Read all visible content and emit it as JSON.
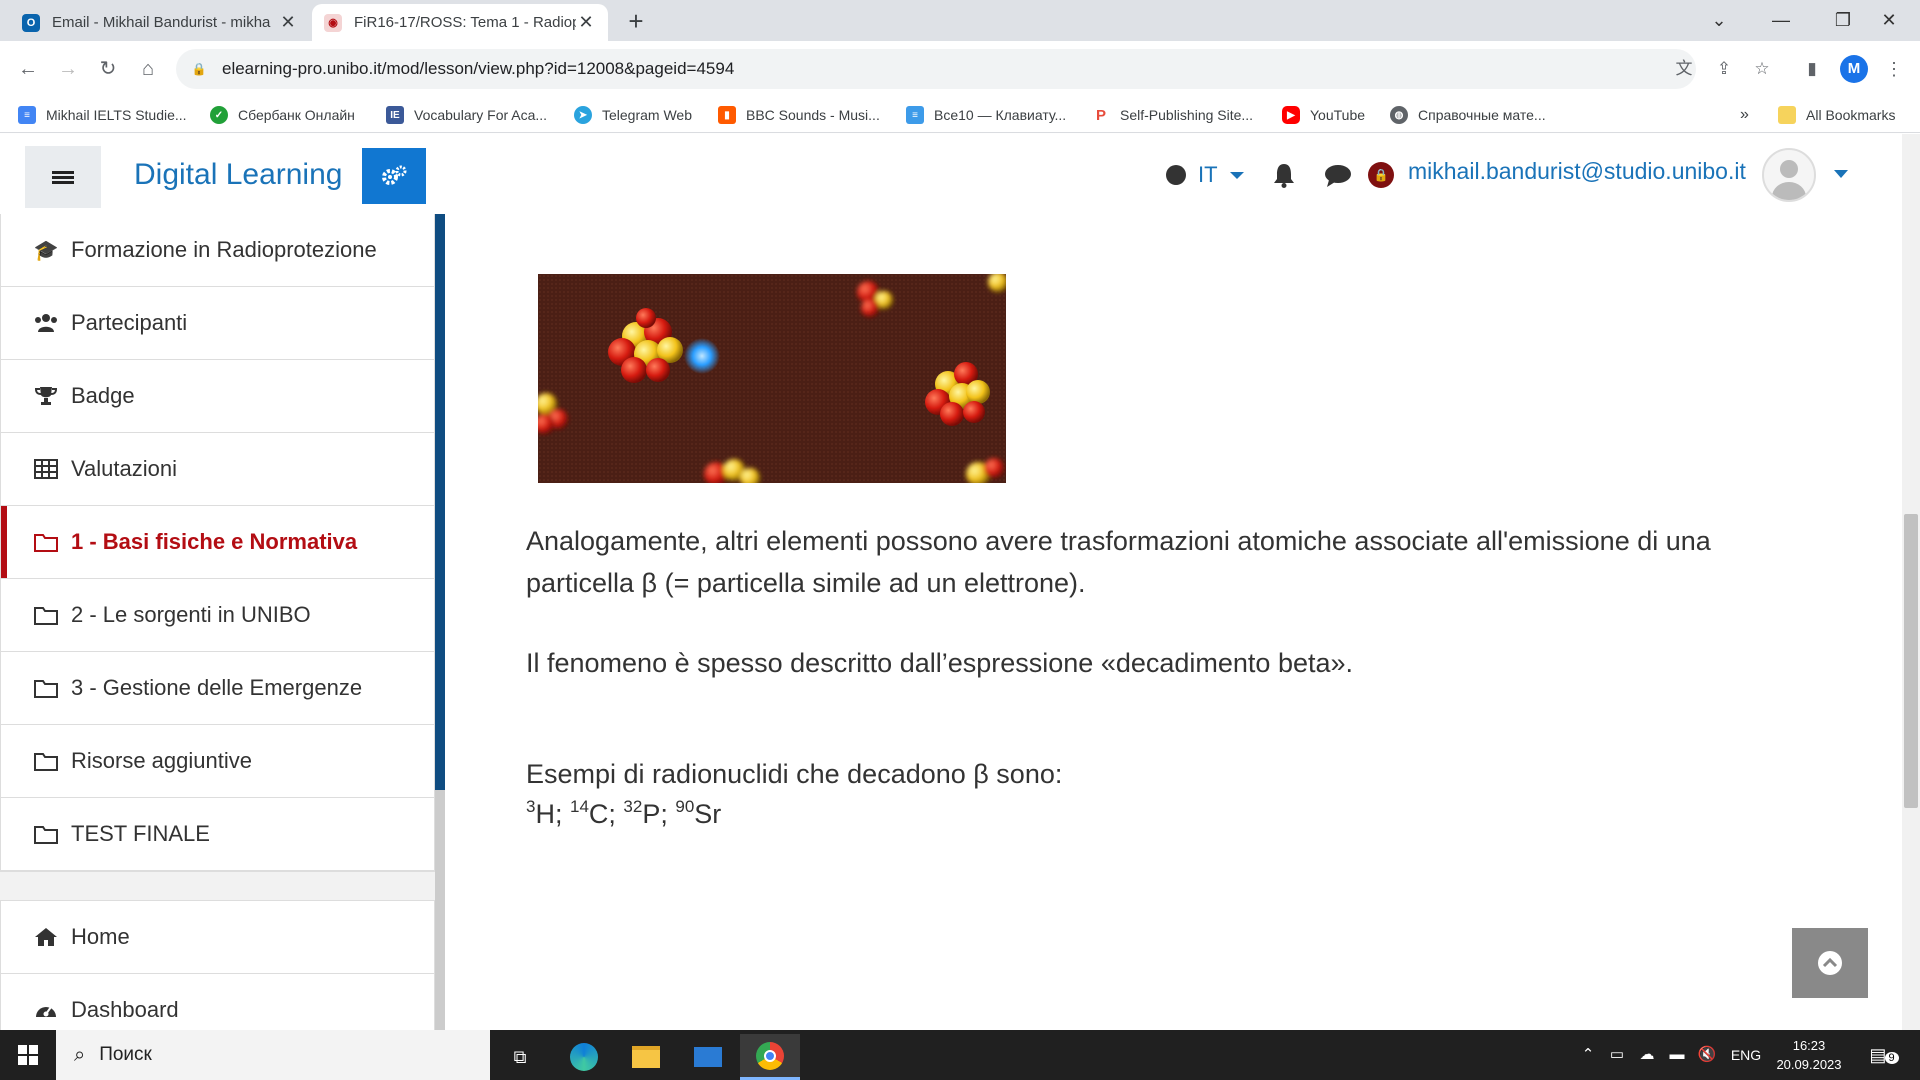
{
  "browser": {
    "tabs": [
      {
        "title": "Email - Mikhail Bandurist - mikha",
        "favicon": "outlook-icon"
      },
      {
        "title": "FiR16-17/ROSS: Tema 1 - Radiopr",
        "favicon": "unibo-icon"
      }
    ],
    "url": "elearning-pro.unibo.it/mod/lesson/view.php?id=12008&pageid=4594",
    "profile_initial": "M",
    "bookmarks": [
      {
        "label": "Mikhail IELTS Studie...",
        "icon": "docs-icon",
        "color": "#4285f4"
      },
      {
        "label": "Сбербанк Онлайн",
        "icon": "sber-icon",
        "color": "#21a038"
      },
      {
        "label": "Vocabulary For Aca...",
        "icon": "ielts-icon",
        "color": "#3b5998"
      },
      {
        "label": "Telegram Web",
        "icon": "telegram-icon",
        "color": "#2aa3de"
      },
      {
        "label": "BBC Sounds - Musi...",
        "icon": "bbc-icon",
        "color": "#ff5a00"
      },
      {
        "label": "Все10 — Клавиату...",
        "icon": "vse10-icon",
        "color": "#3d9be9"
      },
      {
        "label": "Self-Publishing Site...",
        "icon": "publishing-icon",
        "color": "#e74c3c"
      },
      {
        "label": "YouTube",
        "icon": "youtube-icon",
        "color": "#ff0000"
      },
      {
        "label": "Справочные мате...",
        "icon": "globe-icon",
        "color": "#5f6368"
      }
    ],
    "more_bookmarks": "»",
    "all_bookmarks": "All Bookmarks"
  },
  "header": {
    "site_name": "Digital Learning",
    "language": "IT",
    "user_email": "mikhail.bandurist@studio.unibo.it",
    "accent_color": "#1177d1"
  },
  "sidebar": {
    "course_items": [
      {
        "label": "Formazione in Radioprotezione",
        "icon": "graduation-cap-icon",
        "active": false
      },
      {
        "label": "Partecipanti",
        "icon": "users-icon",
        "active": false
      },
      {
        "label": "Badge",
        "icon": "trophy-icon",
        "active": false
      },
      {
        "label": "Valutazioni",
        "icon": "table-icon",
        "active": false
      },
      {
        "label": "1 - Basi fisiche e Normativa",
        "icon": "folder-icon",
        "active": true
      },
      {
        "label": "2 - Le sorgenti in UNIBO",
        "icon": "folder-icon",
        "active": false
      },
      {
        "label": "3 - Gestione delle Emergenze",
        "icon": "folder-icon",
        "active": false
      },
      {
        "label": "Risorse aggiuntive",
        "icon": "folder-icon",
        "active": false
      },
      {
        "label": "TEST FINALE",
        "icon": "folder-icon",
        "active": false
      }
    ],
    "site_items": [
      {
        "label": "Home",
        "icon": "home-icon"
      },
      {
        "label": "Dashboard",
        "icon": "dashboard-icon"
      }
    ],
    "active_color": "#b30d13"
  },
  "lesson": {
    "paragraph1_line1": "Analogamente, altri elementi possono avere trasformazioni atomiche associate all'emissione di una",
    "paragraph1_line2": "particella β (= particella simile ad un elettrone).",
    "paragraph2": "Il fenomeno è spesso descritto dall’espressione «decadimento beta».",
    "examples_intro": "Esempi di radionuclidi che decadono β sono:",
    "nuclides": [
      {
        "mass": "3",
        "symbol": "H",
        "sep": "; "
      },
      {
        "mass": "14",
        "symbol": "C",
        "sep": "; "
      },
      {
        "mass": "32",
        "symbol": "P",
        "sep": "; "
      },
      {
        "mass": "90",
        "symbol": "Sr",
        "sep": ""
      }
    ]
  },
  "taskbar": {
    "search_placeholder": "Поиск",
    "language": "ENG",
    "time": "16:23",
    "date": "20.09.2023",
    "notifications": "9"
  }
}
